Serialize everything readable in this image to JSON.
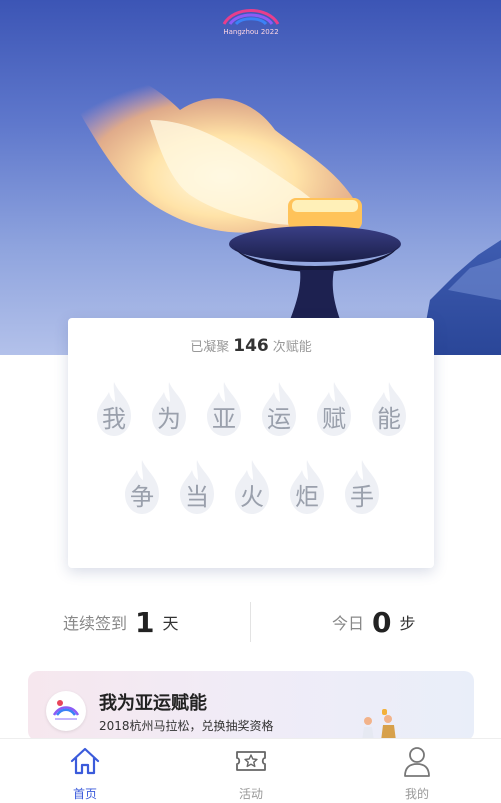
{
  "logo": {
    "text": "Hangzhou 2022"
  },
  "card": {
    "stat_prefix": "已凝聚",
    "stat_count": "146",
    "stat_suffix": "次赋能",
    "row1": [
      "我",
      "为",
      "亚",
      "运",
      "赋",
      "能"
    ],
    "row2": [
      "争",
      "当",
      "火",
      "炬",
      "手"
    ]
  },
  "stats": {
    "checkin_label": "连续签到",
    "checkin_value": "1",
    "checkin_unit": "天",
    "steps_label": "今日",
    "steps_value": "0",
    "steps_unit": "步"
  },
  "banner": {
    "title": "我为亚运赋能",
    "subtitle": "2018杭州马拉松，兑换抽奖资格"
  },
  "tabs": [
    {
      "label": "首页",
      "icon": "home-icon",
      "active": true
    },
    {
      "label": "活动",
      "icon": "ticket-star-icon",
      "active": false
    },
    {
      "label": "我的",
      "icon": "user-icon",
      "active": false
    }
  ],
  "colors": {
    "accent": "#3b5bdb",
    "sky_top": "#3c55b5",
    "flame": "#ffd27a",
    "muted_char": "#9aa0ac"
  }
}
